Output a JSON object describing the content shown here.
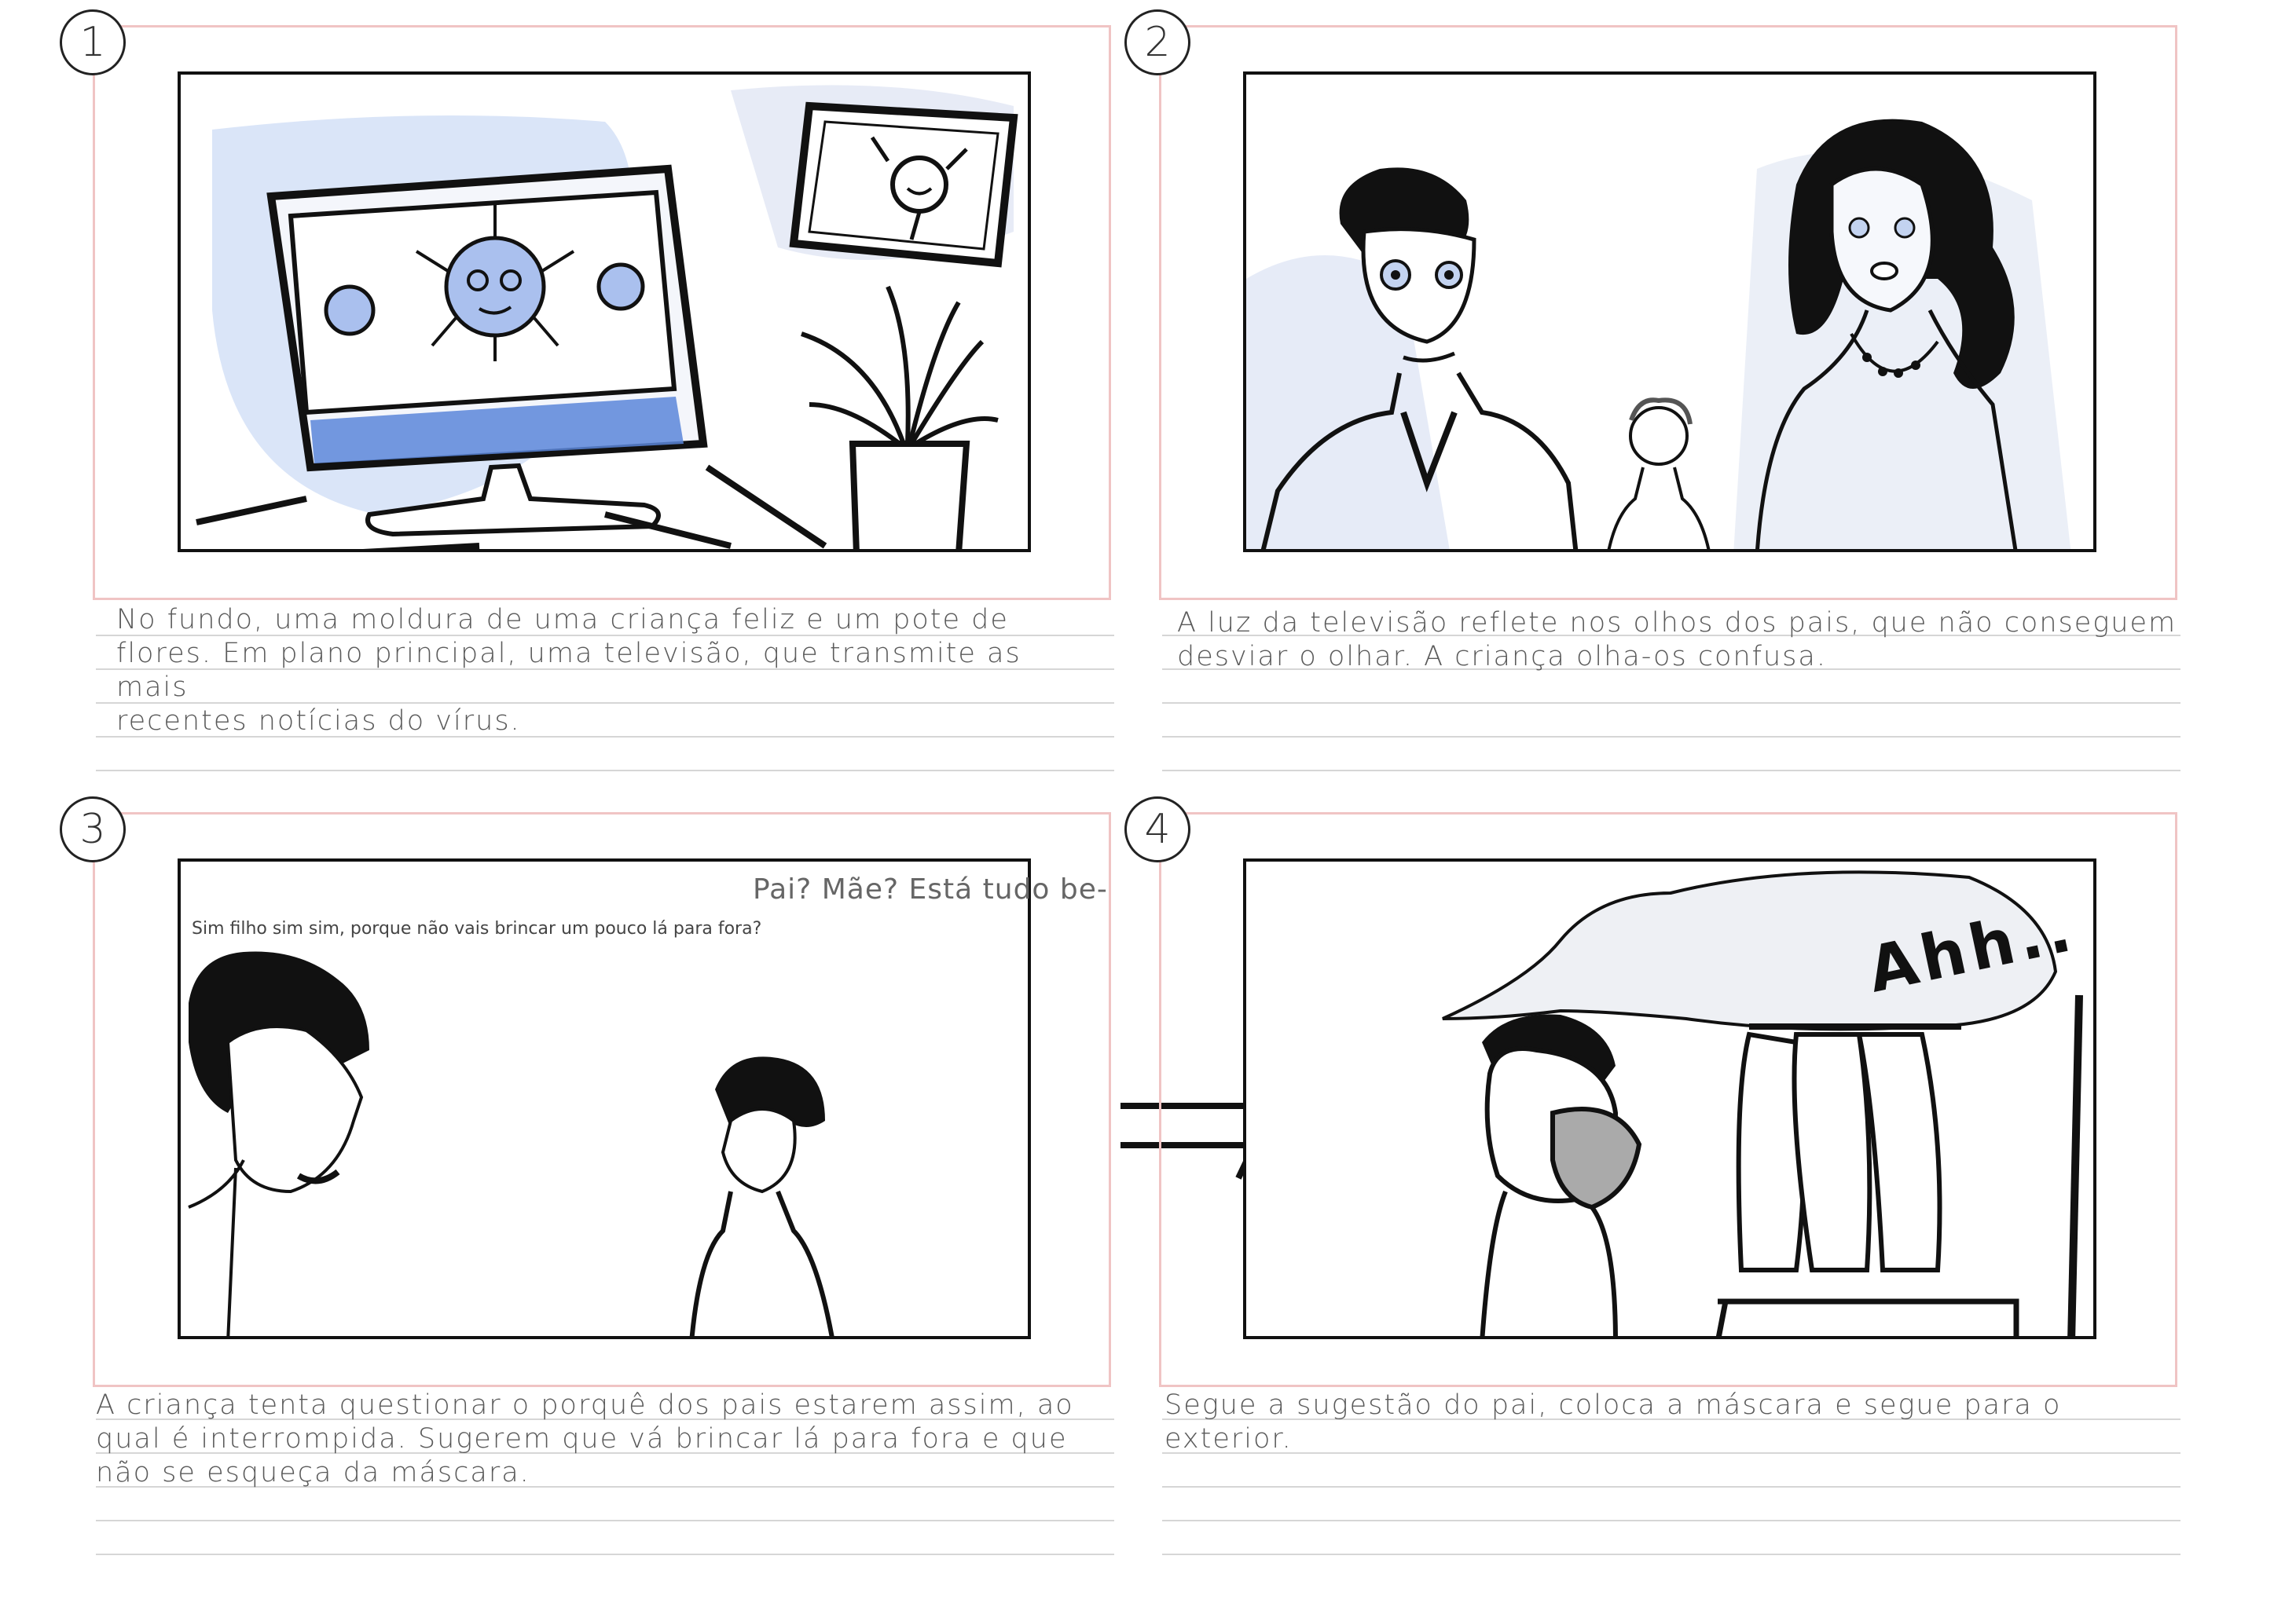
{
  "panels": [
    {
      "number": "1",
      "caption": "No fundo, uma moldura de uma criança feliz e um pote de\nflores. Em plano principal, uma televisão, que transmite as mais\nrecentes notícias do vírus."
    },
    {
      "number": "2",
      "caption": "A luz da televisão reflete nos olhos dos pais, que não conseguem\ndesviar o olhar. A criança olha-os confusa."
    },
    {
      "number": "3",
      "caption": "A criança tenta questionar o porquê dos pais estarem assim, ao\nqual é interrompida. Sugerem que vá brincar lá para fora e que\nnão se esqueça da máscara.",
      "speech_child": "Pai? Mãe? Está tudo be-",
      "speech_parent": "Sim filho sim sim, porque não vais brincar um pouco lá para fora?"
    },
    {
      "number": "4",
      "caption": "Segue a sugestão do pai, coloca a máscara e segue para o\nexterior.",
      "speech_bubble": "Ahh.."
    }
  ],
  "colors": {
    "frame_border": "#f0c4c4",
    "sketch_blue": "#8aa9e6",
    "ink": "#111111",
    "rule": "#d6d6d6"
  }
}
